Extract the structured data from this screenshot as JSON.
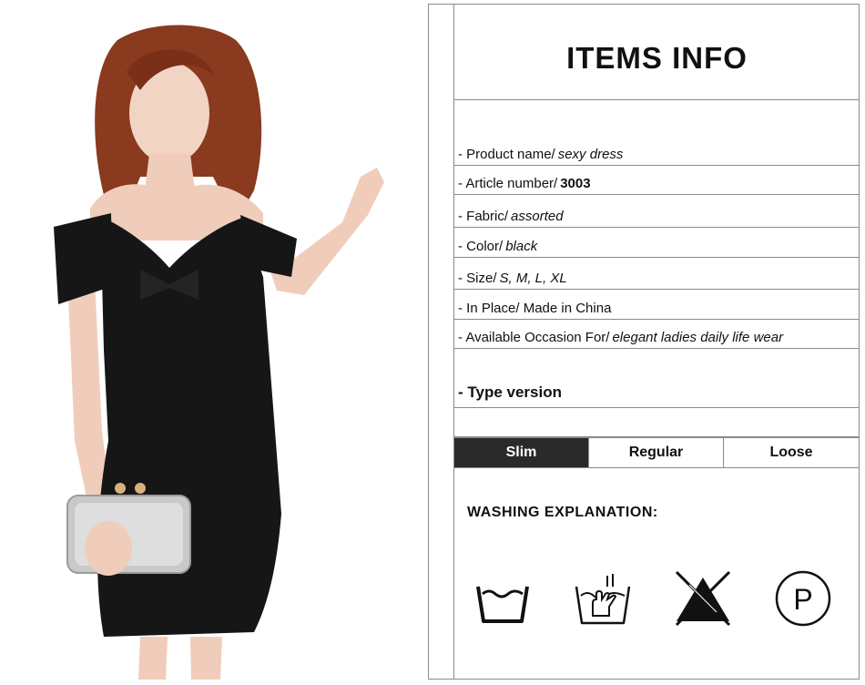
{
  "info": {
    "title": "ITEMS INFO",
    "rows": [
      {
        "label": "- Product name/",
        "value": "sexy dress",
        "bold": false
      },
      {
        "label": "- Article number/",
        "value": "3003",
        "bold": true
      },
      {
        "label": "- Fabric/",
        "value": "assorted",
        "bold": false
      },
      {
        "label": "- Color/",
        "value": "black",
        "bold": false
      },
      {
        "label": "- Size/",
        "value": "S, M, L, XL",
        "bold": false
      },
      {
        "label": "- In Place/ Made in China",
        "value": "",
        "bold": false
      },
      {
        "label": "- Available Occasion For/",
        "value": "elegant ladies daily life wear",
        "bold": false
      }
    ],
    "type_version": "- Type version",
    "fits": [
      {
        "label": "Slim",
        "active": true
      },
      {
        "label": "Regular",
        "active": false
      },
      {
        "label": "Loose",
        "active": false
      }
    ],
    "washing_title": "WASHING EXPLANATION:",
    "care_icons": [
      "wash-tub-icon",
      "hand-wash-icon",
      "do-not-bleach-icon",
      "dry-clean-p-icon"
    ],
    "care_p_letter": "P"
  },
  "colors": {
    "border": "#8a8a8a",
    "active_fit": "#2a2a2a",
    "dress": "#161616",
    "hair": "#8a3a1e"
  }
}
